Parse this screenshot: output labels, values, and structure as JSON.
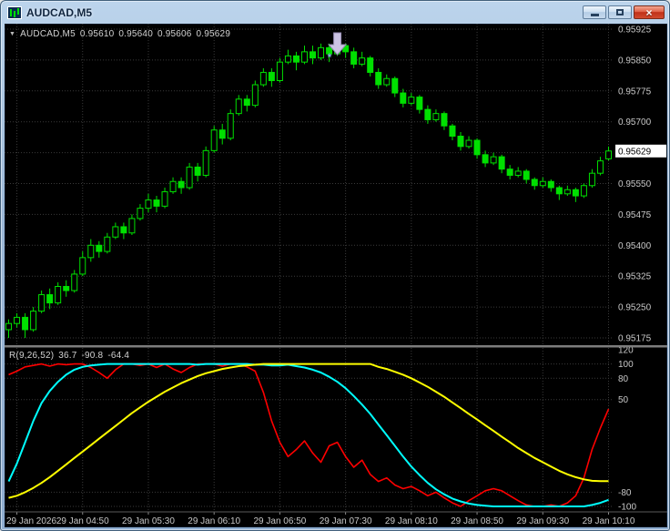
{
  "window": {
    "title": "AUDCAD,M5",
    "controls": {
      "close_glyph": "×"
    }
  },
  "chart": {
    "info": {
      "marker": "▼",
      "symbol": "AUDCAD,M5",
      "open": "0.95610",
      "high": "0.95640",
      "low": "0.95606",
      "close": "0.95629"
    },
    "current_price_label": "0.95629"
  },
  "indicator_label": {
    "name": "R(9,26,52)",
    "value1": "36.7",
    "value2": "-90.8",
    "value3": "-64.4"
  },
  "colors": {
    "candle": "#00e000",
    "bull_fill": "#000000",
    "grid": "#3a3a3a",
    "scale_text": "#c8c8c8",
    "separator": "#7d7d7d",
    "axis_line": "#5a5a5a",
    "price_box_bg": "#ffffff",
    "price_box_text": "#000000",
    "arrow": "#cbc3e3",
    "arrow_outline": "#938ab0",
    "star": "#7fb2d9"
  },
  "chart_data": {
    "type": "candlestick+lines",
    "main": {
      "symbol": "AUDCAD",
      "timeframe": "M5",
      "price_min": 0.95175,
      "price_max": 0.95925,
      "grid_step": 0.00075,
      "price_gridlines": [
        0.95925,
        0.9585,
        0.95775,
        0.957,
        0.95625,
        0.9555,
        0.95475,
        0.954,
        0.95325,
        0.9525,
        0.95175
      ],
      "current_price": 0.95629,
      "candles": [
        [
          0.95195,
          0.9522,
          0.95175,
          0.9521
        ],
        [
          0.9521,
          0.95235,
          0.952,
          0.95225
        ],
        [
          0.95225,
          0.95235,
          0.95175,
          0.95195
        ],
        [
          0.95195,
          0.9525,
          0.9519,
          0.9524
        ],
        [
          0.9524,
          0.9529,
          0.95235,
          0.9528
        ],
        [
          0.9528,
          0.95295,
          0.95245,
          0.9526
        ],
        [
          0.9526,
          0.9531,
          0.95255,
          0.953
        ],
        [
          0.953,
          0.95315,
          0.95275,
          0.9529
        ],
        [
          0.9529,
          0.9534,
          0.95285,
          0.9533
        ],
        [
          0.9533,
          0.95385,
          0.95325,
          0.9537
        ],
        [
          0.9537,
          0.95415,
          0.9536,
          0.954
        ],
        [
          0.954,
          0.9541,
          0.9537,
          0.95385
        ],
        [
          0.95385,
          0.9543,
          0.9538,
          0.9542
        ],
        [
          0.9542,
          0.95455,
          0.95415,
          0.95445
        ],
        [
          0.95445,
          0.95455,
          0.95415,
          0.9543
        ],
        [
          0.9543,
          0.95475,
          0.95425,
          0.95465
        ],
        [
          0.95465,
          0.955,
          0.9546,
          0.9549
        ],
        [
          0.9549,
          0.95525,
          0.9548,
          0.9551
        ],
        [
          0.9551,
          0.9552,
          0.9548,
          0.95495
        ],
        [
          0.95495,
          0.9554,
          0.9549,
          0.9553
        ],
        [
          0.9553,
          0.95565,
          0.95525,
          0.95555
        ],
        [
          0.95555,
          0.95565,
          0.95525,
          0.9554
        ],
        [
          0.9554,
          0.956,
          0.95535,
          0.9559
        ],
        [
          0.9559,
          0.956,
          0.95555,
          0.9557
        ],
        [
          0.9557,
          0.9564,
          0.95565,
          0.9563
        ],
        [
          0.9563,
          0.9569,
          0.95625,
          0.9568
        ],
        [
          0.9568,
          0.95695,
          0.95645,
          0.9566
        ],
        [
          0.9566,
          0.9573,
          0.95655,
          0.9572
        ],
        [
          0.9572,
          0.95765,
          0.95715,
          0.95755
        ],
        [
          0.95755,
          0.95765,
          0.95725,
          0.9574
        ],
        [
          0.9574,
          0.958,
          0.95735,
          0.9579
        ],
        [
          0.9579,
          0.9583,
          0.95785,
          0.9582
        ],
        [
          0.9582,
          0.9583,
          0.95785,
          0.958
        ],
        [
          0.958,
          0.95855,
          0.95795,
          0.95845
        ],
        [
          0.95845,
          0.95875,
          0.9584,
          0.9586
        ],
        [
          0.9586,
          0.9587,
          0.95825,
          0.95845
        ],
        [
          0.95845,
          0.95885,
          0.9584,
          0.9587
        ],
        [
          0.9587,
          0.95885,
          0.9584,
          0.95855
        ],
        [
          0.95855,
          0.9589,
          0.9585,
          0.9588
        ],
        [
          0.9588,
          0.9589,
          0.95845,
          0.95865
        ],
        [
          0.95865,
          0.95895,
          0.9586,
          0.95885
        ],
        [
          0.95885,
          0.9589,
          0.95855,
          0.9587
        ],
        [
          0.9587,
          0.9588,
          0.9583,
          0.9584
        ],
        [
          0.9584,
          0.9587,
          0.95835,
          0.95855
        ],
        [
          0.95855,
          0.9586,
          0.9581,
          0.9582
        ],
        [
          0.9582,
          0.9583,
          0.9578,
          0.9579
        ],
        [
          0.9579,
          0.95815,
          0.95785,
          0.95805
        ],
        [
          0.95805,
          0.9581,
          0.9576,
          0.9577
        ],
        [
          0.9577,
          0.9578,
          0.95735,
          0.95745
        ],
        [
          0.95745,
          0.9577,
          0.9574,
          0.9576
        ],
        [
          0.9576,
          0.95765,
          0.9572,
          0.9573
        ],
        [
          0.9573,
          0.9574,
          0.95695,
          0.95705
        ],
        [
          0.95705,
          0.9573,
          0.957,
          0.9572
        ],
        [
          0.9572,
          0.95725,
          0.9568,
          0.9569
        ],
        [
          0.9569,
          0.95695,
          0.95655,
          0.95665
        ],
        [
          0.95665,
          0.95675,
          0.9563,
          0.9564
        ],
        [
          0.9564,
          0.95665,
          0.95635,
          0.95655
        ],
        [
          0.95655,
          0.9566,
          0.9561,
          0.9562
        ],
        [
          0.9562,
          0.9563,
          0.9559,
          0.956
        ],
        [
          0.956,
          0.95625,
          0.95595,
          0.95615
        ],
        [
          0.95615,
          0.9562,
          0.95575,
          0.95585
        ],
        [
          0.95585,
          0.95595,
          0.9556,
          0.9557
        ],
        [
          0.9557,
          0.9559,
          0.95565,
          0.9558
        ],
        [
          0.9558,
          0.95585,
          0.9555,
          0.9556
        ],
        [
          0.9556,
          0.95565,
          0.95535,
          0.95545
        ],
        [
          0.95545,
          0.95565,
          0.9554,
          0.95555
        ],
        [
          0.95555,
          0.9556,
          0.9553,
          0.9554
        ],
        [
          0.9554,
          0.95545,
          0.9551,
          0.95525
        ],
        [
          0.95525,
          0.95545,
          0.9552,
          0.95535
        ],
        [
          0.95535,
          0.9554,
          0.95505,
          0.9552
        ],
        [
          0.9552,
          0.9555,
          0.95515,
          0.95545
        ],
        [
          0.95545,
          0.95585,
          0.9554,
          0.95575
        ],
        [
          0.95575,
          0.95615,
          0.9557,
          0.95605
        ],
        [
          0.9561,
          0.9564,
          0.95606,
          0.95629
        ]
      ]
    },
    "indicator": {
      "name": "R(9,26,52)",
      "current_values": [
        36.7,
        -90.8,
        -64.4
      ],
      "scale_min": -100,
      "scale_max": 120,
      "scale_labels": [
        120,
        100,
        80,
        50,
        -80,
        -100
      ],
      "series": [
        {
          "name": "fast-red",
          "color": "#ff0000",
          "width": 1.6,
          "values": [
            85,
            90,
            96,
            98,
            100,
            97,
            100,
            99,
            100,
            100,
            95,
            88,
            80,
            92,
            100,
            100,
            98,
            100,
            95,
            100,
            93,
            88,
            95,
            100,
            100,
            100,
            97,
            100,
            100,
            96,
            90,
            60,
            20,
            -10,
            -30,
            -20,
            -8,
            -25,
            -38,
            -15,
            -10,
            -30,
            -45,
            -35,
            -55,
            -65,
            -60,
            -70,
            -75,
            -72,
            -78,
            -85,
            -80,
            -88,
            -95,
            -100,
            -92,
            -85,
            -78,
            -75,
            -78,
            -85,
            -92,
            -98,
            -100,
            -100,
            -98,
            -100,
            -95,
            -85,
            -60,
            -20,
            10,
            36.7
          ]
        },
        {
          "name": "mid-aqua",
          "color": "#00ffff",
          "width": 2,
          "values": [
            -65,
            -40,
            -10,
            20,
            45,
            62,
            75,
            85,
            92,
            96,
            98,
            99,
            100,
            100,
            100,
            100,
            100,
            100,
            100,
            100,
            100,
            100,
            100,
            99,
            100,
            100,
            100,
            100,
            100,
            100,
            99,
            99,
            98,
            98,
            99,
            97,
            95,
            92,
            88,
            82,
            75,
            66,
            55,
            43,
            30,
            15,
            0,
            -15,
            -30,
            -44,
            -56,
            -67,
            -76,
            -83,
            -89,
            -93,
            -96,
            -98,
            -99,
            -100,
            -100,
            -100,
            -100,
            -100,
            -100,
            -100,
            -100,
            -100,
            -100,
            -100,
            -100,
            -98,
            -95,
            -90.8
          ]
        },
        {
          "name": "slow-yellow",
          "color": "#ffff00",
          "width": 2,
          "values": [
            -88,
            -85,
            -80,
            -74,
            -67,
            -59,
            -50,
            -41,
            -32,
            -23,
            -14,
            -5,
            4,
            13,
            22,
            31,
            39,
            47,
            54,
            61,
            67,
            73,
            78,
            83,
            87,
            90,
            93,
            95,
            97,
            98,
            99,
            100,
            100,
            100,
            100,
            100,
            100,
            100,
            100,
            100,
            100,
            100,
            100,
            100,
            100,
            96,
            93,
            89,
            85,
            80,
            74,
            68,
            61,
            54,
            46,
            38,
            30,
            22,
            14,
            6,
            -2,
            -10,
            -18,
            -25,
            -32,
            -38,
            -44,
            -50,
            -55,
            -59,
            -62,
            -64,
            -64.5,
            -64.4
          ]
        }
      ]
    },
    "time_labels": [
      {
        "text": "29 Jan 2026",
        "index": 1,
        "align": "left"
      },
      {
        "text": "29 Jan 04:50",
        "index": 9
      },
      {
        "text": "29 Jan 05:30",
        "index": 17
      },
      {
        "text": "29 Jan 06:10",
        "index": 25
      },
      {
        "text": "29 Jan 06:50",
        "index": 33
      },
      {
        "text": "29 Jan 07:30",
        "index": 41
      },
      {
        "text": "29 Jan 08:10",
        "index": 49
      },
      {
        "text": "29 Jan 08:50",
        "index": 57
      },
      {
        "text": "29 Jan 09:30",
        "index": 65
      },
      {
        "text": "29 Jan 10:10",
        "index": 73
      }
    ],
    "annotations": [
      {
        "type": "down-arrow",
        "x_index": 40,
        "star_glyph": "*"
      }
    ]
  }
}
